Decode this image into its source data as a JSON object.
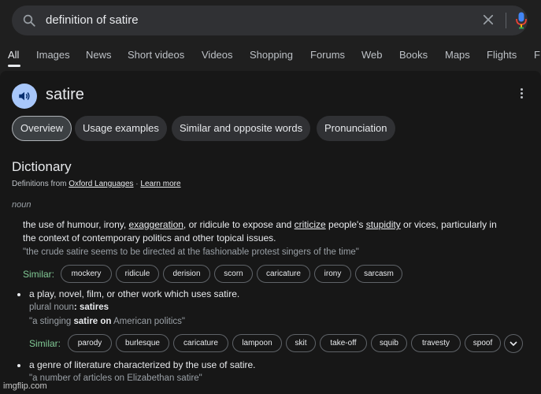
{
  "search": {
    "query": "definition of satire"
  },
  "nav_tabs": [
    "All",
    "Images",
    "News",
    "Short videos",
    "Videos",
    "Shopping",
    "Forums",
    "Web",
    "Books",
    "Maps",
    "Flights",
    "F"
  ],
  "result": {
    "word": "satire",
    "chips": [
      "Overview",
      "Usage examples",
      "Similar and opposite words",
      "Pronunciation"
    ],
    "dictionary_title": "Dictionary",
    "source_prefix": "Definitions from ",
    "source_link": "Oxford Languages",
    "separator": " · ",
    "learn_more": "Learn more",
    "pos": "noun",
    "def1": {
      "p1": "the use of humour, irony, ",
      "w1": "exaggeration",
      "p2": ", or ridicule to expose and ",
      "w2": "criticize",
      "p3": " people's ",
      "w3": "stupidity",
      "p4": " or vices, particularly in",
      "line2": "the context of contemporary politics and other topical issues.",
      "example": "\"the crude satire seems to be directed at the fashionable protest singers of the time\"",
      "similar_label": "Similar:",
      "similar": [
        "mockery",
        "ridicule",
        "derision",
        "scorn",
        "caricature",
        "irony",
        "sarcasm"
      ]
    },
    "def2": {
      "text": "a play, novel, film, or other work which uses satire.",
      "plural_label": "plural noun",
      "plural_sep": ": ",
      "plural_value": "satires",
      "ex_open": "\"a stinging ",
      "ex_bold": "satire on",
      "ex_close": " American politics\"",
      "similar_label": "Similar:",
      "similar": [
        "parody",
        "burlesque",
        "caricature",
        "lampoon",
        "skit",
        "take-off",
        "squib",
        "travesty",
        "spoof"
      ]
    },
    "def3": {
      "text": "a genre of literature characterized by the use of satire.",
      "example": "\"a number of articles on Elizabethan satire\""
    }
  },
  "watermark": "imgflip.com",
  "colors": {
    "background": "#1f1f1f",
    "panel": "#171717",
    "similar_label": "#81c995",
    "speaker_bg": "#a8c7fa"
  }
}
